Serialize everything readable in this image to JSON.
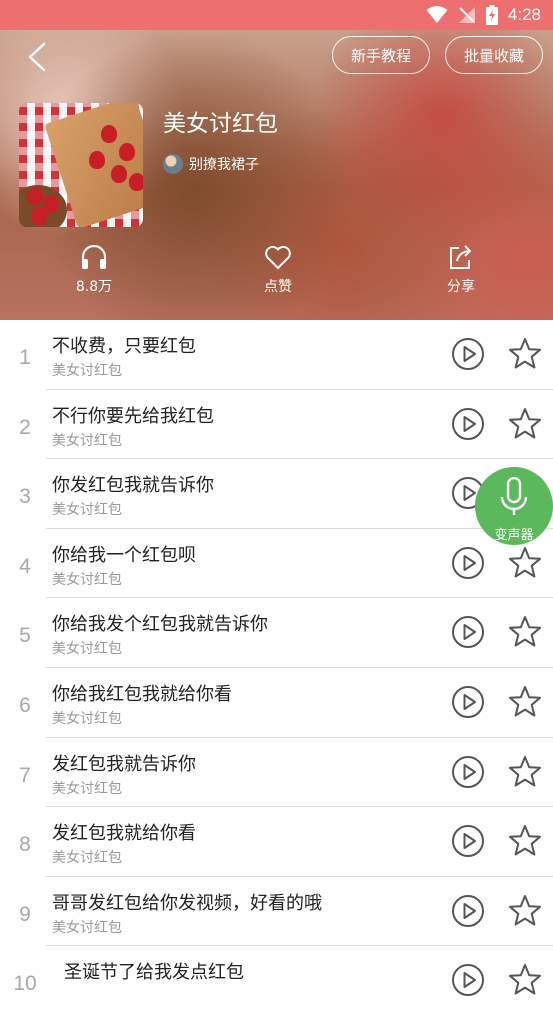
{
  "status_bar": {
    "time": "4:28"
  },
  "header": {
    "tutorial_label": "新手教程",
    "batch_collect_label": "批量收藏"
  },
  "album": {
    "title": "美女讨红包",
    "author": "别撩我裙子",
    "plays": "8.8万",
    "like_label": "点赞",
    "share_label": "分享"
  },
  "tracks": [
    {
      "index": "1",
      "title": "不收费，只要红包",
      "subtitle": "美女讨红包"
    },
    {
      "index": "2",
      "title": "不行你要先给我红包",
      "subtitle": "美女讨红包"
    },
    {
      "index": "3",
      "title": "你发红包我就告诉你",
      "subtitle": "美女讨红包"
    },
    {
      "index": "4",
      "title": "你给我一个红包呗",
      "subtitle": "美女讨红包"
    },
    {
      "index": "5",
      "title": "你给我发个红包我就告诉你",
      "subtitle": "美女讨红包"
    },
    {
      "index": "6",
      "title": "你给我红包我就给你看",
      "subtitle": "美女讨红包"
    },
    {
      "index": "7",
      "title": "发红包我就告诉你",
      "subtitle": "美女讨红包"
    },
    {
      "index": "8",
      "title": "发红包我就给你看",
      "subtitle": "美女讨红包"
    },
    {
      "index": "9",
      "title": "哥哥发红包给你发视频，好看的哦",
      "subtitle": "美女讨红包"
    },
    {
      "index": "10",
      "title": "圣诞节了给我发点红包",
      "subtitle": ""
    }
  ],
  "fab": {
    "label": "变声器"
  },
  "icons": {
    "back": "chevron-left-icon",
    "headphones": "headphones-icon",
    "heart": "heart-icon",
    "share": "share-icon",
    "play": "play-circle-icon",
    "star": "star-outline-icon",
    "mic": "microphone-icon",
    "wifi": "wifi-icon",
    "signal": "no-signal-icon",
    "battery": "battery-charging-icon"
  },
  "colors": {
    "status_bar": "#ee6f6f",
    "fab": "#5cb85c",
    "icon_gray": "#555555"
  }
}
